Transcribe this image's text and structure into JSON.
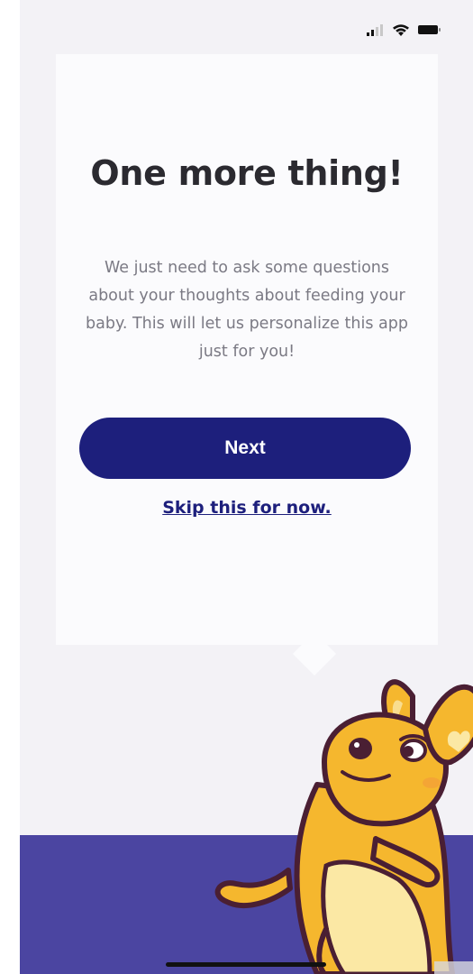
{
  "status_bar": {
    "signal_icon": "cellular-signal-icon",
    "wifi_icon": "wifi-icon",
    "battery_icon": "battery-icon"
  },
  "card": {
    "title": "One more thing!",
    "body_lines": [
      "We just need to ask some questions",
      "about your thoughts about feeding your",
      "baby. This will let us personalize this app",
      "just for you!"
    ],
    "next_label": "Next",
    "skip_label": "Skip this for now."
  },
  "mascot": {
    "icon": "kangaroo-mascot-icon"
  },
  "colors": {
    "primary": "#1d1f7c",
    "band": "#4b45a1",
    "mascot_body": "#f5b72e",
    "mascot_outline": "#4a1f33",
    "background": "#f3f2f6"
  }
}
